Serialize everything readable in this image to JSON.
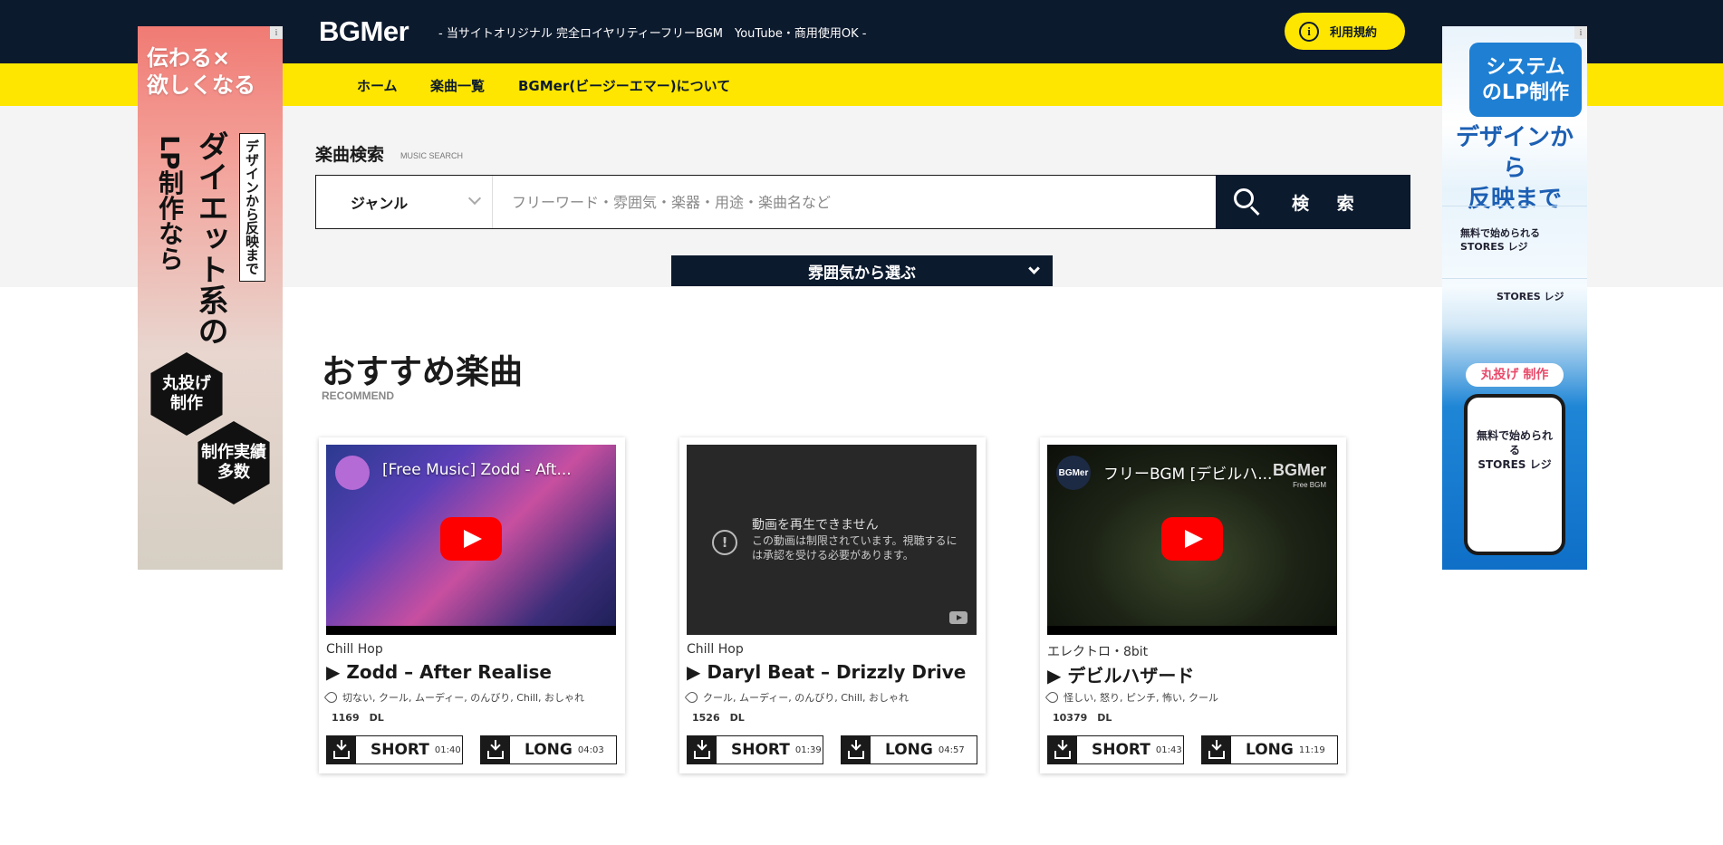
{
  "header": {
    "logo": "BGMer",
    "tagline": "- 当サイトオリジナル 完全ロイヤリティーフリーBGM　YouTube・商用使用OK -",
    "terms_label": "利用規約",
    "terms_icon": "i"
  },
  "nav": {
    "items": [
      {
        "label": "ホーム"
      },
      {
        "label": "楽曲一覧"
      },
      {
        "label": "BGMer(ビージーエマー)について"
      }
    ]
  },
  "search": {
    "title": "楽曲検索",
    "subtitle": "MUSIC SEARCH",
    "genre_label": "ジャンル",
    "placeholder": "フリーワード・雰囲気・楽器・用途・楽曲名など",
    "button_label": "検 索",
    "mood_label": "雰囲気から選ぶ"
  },
  "recommend": {
    "title": "おすすめ楽曲",
    "subtitle": "RECOMMEND",
    "cards": [
      {
        "video_title": "[Free Music] Zodd - Aft...",
        "genre": "Chill Hop",
        "title": "▶ Zodd – After Realise",
        "tags": "切ない, クール, ムーディー, のんびり, Chill, おしゃれ",
        "downloads": "1169　DL",
        "short_label": "SHORT",
        "short_duration": "01:40",
        "long_label": "LONG",
        "long_duration": "04:03"
      },
      {
        "error_title": "動画を再生できません",
        "error_message": "この動画は制限されています。視聴するには承認を受ける必要があります。",
        "error_icon": "!",
        "genre": "Chill Hop",
        "title": "▶ Daryl Beat – Drizzly Drive",
        "tags": "クール, ムーディー, のんびり, Chill, おしゃれ",
        "downloads": "1526　DL",
        "short_label": "SHORT",
        "short_duration": "01:39",
        "long_label": "LONG",
        "long_duration": "04:57"
      },
      {
        "channel_avatar": "BGMer",
        "video_title": "フリーBGM [デビルハ...",
        "watermark": "BGMer",
        "watermark_sub": "Free BGM",
        "genre": "エレクトロ・8bit",
        "title": "▶ デビルハザード",
        "tags": "怪しい, 怒り, ピンチ, 怖い, クール",
        "downloads": "10379　DL",
        "short_label": "SHORT",
        "short_duration": "01:43",
        "long_label": "LONG",
        "long_duration": "11:19"
      }
    ]
  },
  "ads": {
    "info_icon": "i",
    "left": {
      "headline": "伝わる×\n欲しくなる",
      "vertical_small": "デザインから反映まで",
      "vertical_big": "ダイエット系の",
      "vertical_mid": "LP制作なら",
      "hex1": "丸投げ\n制作",
      "hex2": "制作実績\n多数"
    },
    "right": {
      "headline": "システム\nのLP制作",
      "sub": "デザインから\n反映まで",
      "panel1": "無料で始められる\nSTORES レジ",
      "panel2": "STORES レジ",
      "tag": "丸投げ 制作",
      "phone_text": "無料で始められる\nSTORES レジ"
    }
  },
  "colors": {
    "navy": "#0c1a2e",
    "yellow": "#ffe600",
    "youtube_red": "#ff0000"
  }
}
